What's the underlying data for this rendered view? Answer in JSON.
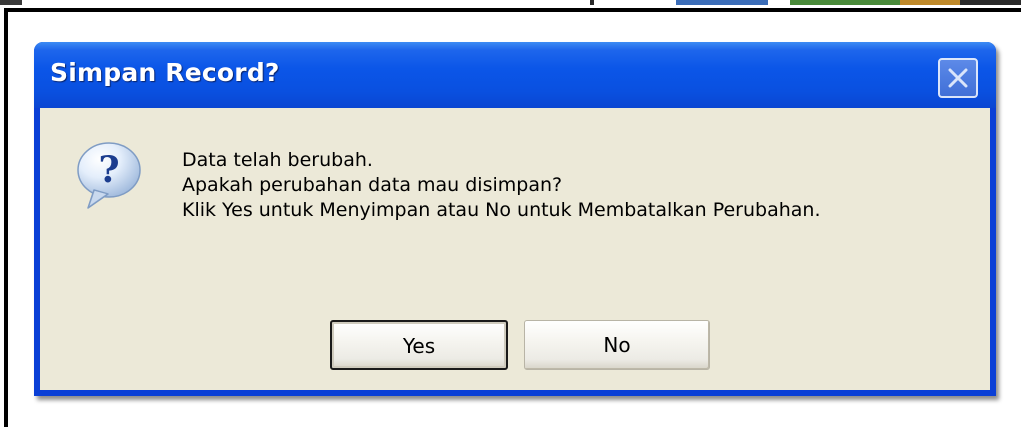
{
  "dialog": {
    "title": "Simpan Record?",
    "close_icon": "close-icon",
    "icon": "question-icon",
    "message_lines": [
      "Data telah berubah.",
      "Apakah perubahan data mau disimpan?",
      "Klik Yes untuk Menyimpan atau No untuk Membatalkan Perubahan."
    ],
    "buttons": {
      "yes_label": "Yes",
      "no_label": "No"
    },
    "default_button": "Yes"
  },
  "colors": {
    "titlebar": "#0a50e0",
    "client_background": "#ece9d8",
    "title_text": "#ffffff"
  }
}
